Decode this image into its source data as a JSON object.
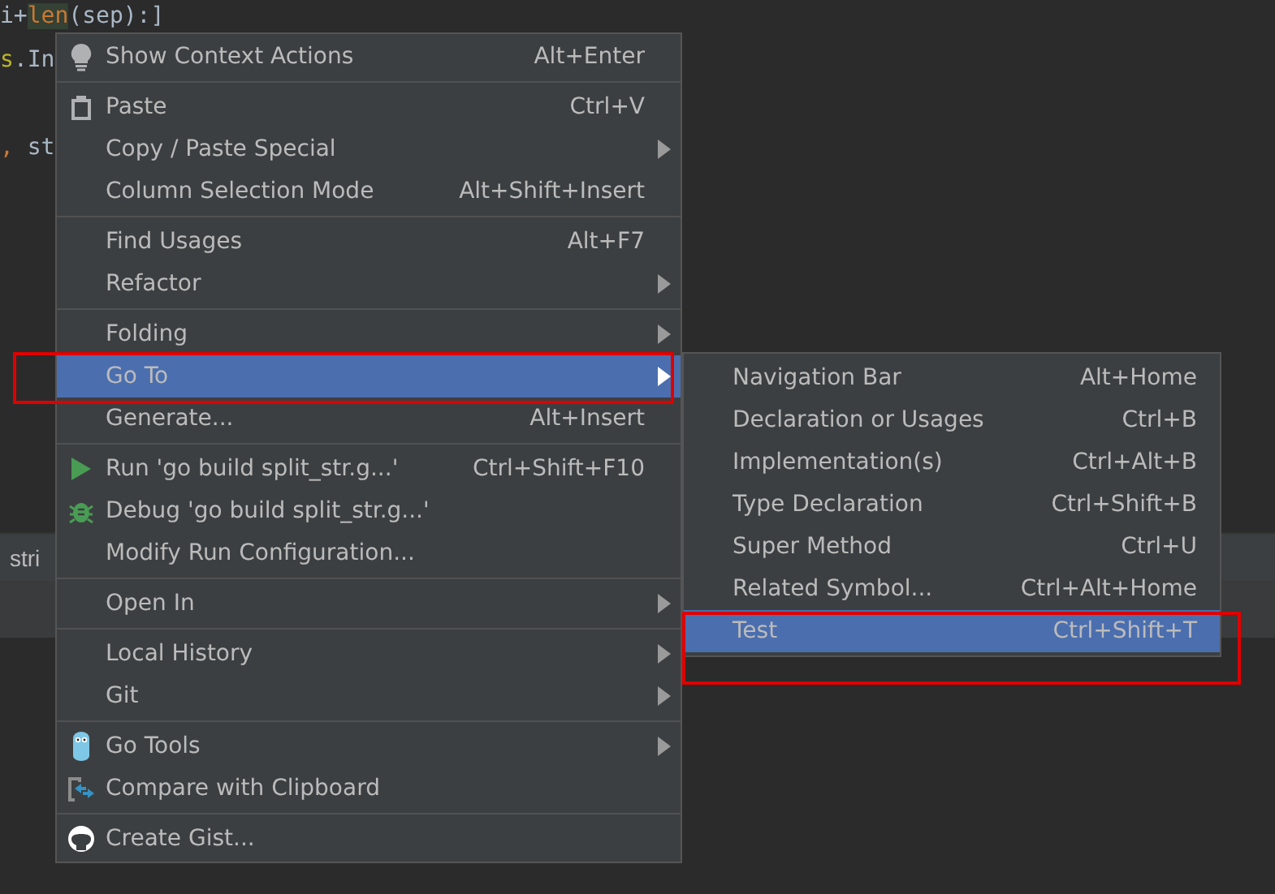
{
  "editor": {
    "lines": [
      {
        "tokens": [
          {
            "text": "i+",
            "color": "#a9b7c6",
            "highlighted": false
          },
          {
            "text": "len",
            "color": "#cc7832",
            "highlighted": true
          },
          {
            "text": "(sep):]",
            "color": "#a9b7c6",
            "highlighted": false
          }
        ]
      },
      {
        "tokens": [
          {
            "text": "s",
            "color": "#bbb529",
            "highlighted": false
          },
          {
            "text": ".In",
            "color": "#a9b7c6",
            "highlighted": false
          }
        ]
      },
      {
        "tokens": [
          {
            "text": ",",
            "color": "#cc7832",
            "highlighted": false
          },
          {
            "text": " st",
            "color": "#a9b7c6",
            "highlighted": false
          }
        ]
      }
    ]
  },
  "tool_window": {
    "title": "stri"
  },
  "context_menu": {
    "groups": [
      [
        {
          "kind": "context-actions",
          "label": "Show Context Actions",
          "shortcut": "Alt+Enter",
          "submenu": false,
          "selected": false
        }
      ],
      [
        {
          "kind": "paste",
          "label": "Paste",
          "shortcut": "Ctrl+V",
          "submenu": false,
          "selected": false
        },
        {
          "kind": "plain",
          "label": "Copy / Paste Special",
          "submenu": true,
          "selected": false
        },
        {
          "kind": "plain",
          "label": "Column Selection Mode",
          "shortcut": "Alt+Shift+Insert",
          "submenu": false,
          "selected": false
        }
      ],
      [
        {
          "kind": "plain",
          "label": "Find Usages",
          "shortcut": "Alt+F7",
          "submenu": false,
          "selected": false
        },
        {
          "kind": "plain",
          "label": "Refactor",
          "submenu": true,
          "selected": false
        }
      ],
      [
        {
          "kind": "plain",
          "label": "Folding",
          "submenu": true,
          "selected": false
        },
        {
          "kind": "plain",
          "label": "Go To",
          "submenu": true,
          "selected": true
        },
        {
          "kind": "plain",
          "label": "Generate...",
          "shortcut": "Alt+Insert",
          "submenu": false,
          "selected": false
        }
      ],
      [
        {
          "kind": "run",
          "label": "Run 'go build split_str.g...'",
          "shortcut": "Ctrl+Shift+F10",
          "submenu": false,
          "selected": false
        },
        {
          "kind": "debug",
          "label": "Debug 'go build split_str.g...'",
          "submenu": false,
          "selected": false
        },
        {
          "kind": "plain",
          "label": "Modify Run Configuration...",
          "submenu": false,
          "selected": false
        }
      ],
      [
        {
          "kind": "plain",
          "label": "Open In",
          "submenu": true,
          "selected": false
        }
      ],
      [
        {
          "kind": "plain",
          "label": "Local History",
          "submenu": true,
          "selected": false
        },
        {
          "kind": "plain",
          "label": "Git",
          "submenu": true,
          "selected": false
        }
      ],
      [
        {
          "kind": "go-tools",
          "label": "Go Tools",
          "submenu": true,
          "selected": false
        },
        {
          "kind": "compare",
          "label": "Compare with Clipboard",
          "submenu": false,
          "selected": false
        }
      ],
      [
        {
          "kind": "gist",
          "label": "Create Gist...",
          "submenu": false,
          "selected": false
        }
      ]
    ]
  },
  "submenu": {
    "items": [
      {
        "label": "Navigation Bar",
        "shortcut": "Alt+Home",
        "selected": false
      },
      {
        "label": "Declaration or Usages",
        "shortcut": "Ctrl+B",
        "selected": false
      },
      {
        "label": "Implementation(s)",
        "shortcut": "Ctrl+Alt+B",
        "selected": false
      },
      {
        "label": "Type Declaration",
        "shortcut": "Ctrl+Shift+B",
        "selected": false
      },
      {
        "label": "Super Method",
        "shortcut": "Ctrl+U",
        "selected": false
      },
      {
        "label": "Related Symbol...",
        "shortcut": "Ctrl+Alt+Home",
        "selected": false
      },
      {
        "label": "Test",
        "shortcut": "Ctrl+Shift+T",
        "selected": true
      }
    ]
  }
}
